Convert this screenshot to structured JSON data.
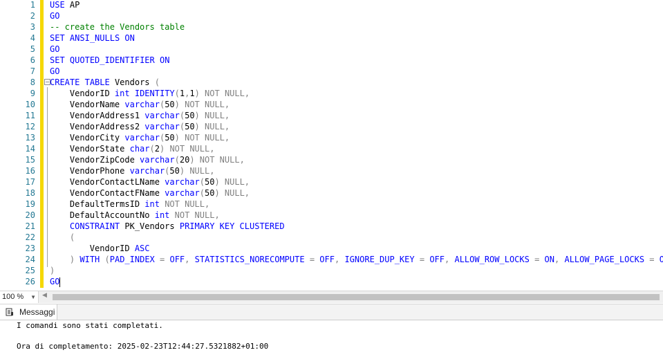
{
  "editor": {
    "lines": [
      {
        "n": "1",
        "parts": [
          [
            "kw",
            "USE"
          ],
          [
            "id",
            " AP"
          ]
        ]
      },
      {
        "n": "2",
        "parts": [
          [
            "kw",
            "GO"
          ]
        ]
      },
      {
        "n": "3",
        "parts": [
          [
            "cm",
            "-- create the Vendors table"
          ]
        ]
      },
      {
        "n": "4",
        "parts": [
          [
            "kw",
            "SET"
          ],
          [
            "id",
            " "
          ],
          [
            "kw",
            "ANSI_NULLS"
          ],
          [
            "id",
            " "
          ],
          [
            "kw",
            "ON"
          ]
        ]
      },
      {
        "n": "5",
        "parts": [
          [
            "kw",
            "GO"
          ]
        ]
      },
      {
        "n": "6",
        "parts": [
          [
            "kw",
            "SET"
          ],
          [
            "id",
            " "
          ],
          [
            "kw",
            "QUOTED_IDENTIFIER"
          ],
          [
            "id",
            " "
          ],
          [
            "kw",
            "ON"
          ]
        ]
      },
      {
        "n": "7",
        "parts": [
          [
            "kw",
            "GO"
          ]
        ]
      },
      {
        "n": "8",
        "parts": [
          [
            "kw",
            "CREATE"
          ],
          [
            "id",
            " "
          ],
          [
            "kw",
            "TABLE"
          ],
          [
            "id",
            " Vendors "
          ],
          [
            "gr",
            "("
          ]
        ]
      },
      {
        "n": "9",
        "parts": [
          [
            "id",
            "    VendorID "
          ],
          [
            "kw",
            "int"
          ],
          [
            "id",
            " "
          ],
          [
            "kw",
            "IDENTITY"
          ],
          [
            "gr",
            "("
          ],
          [
            "id",
            "1"
          ],
          [
            "gr",
            ","
          ],
          [
            "id",
            "1"
          ],
          [
            "gr",
            ")"
          ],
          [
            "id",
            " "
          ],
          [
            "gr",
            "NOT NULL,"
          ]
        ]
      },
      {
        "n": "10",
        "parts": [
          [
            "id",
            "    VendorName "
          ],
          [
            "kw",
            "varchar"
          ],
          [
            "gr",
            "("
          ],
          [
            "id",
            "50"
          ],
          [
            "gr",
            ")"
          ],
          [
            "id",
            " "
          ],
          [
            "gr",
            "NOT NULL,"
          ]
        ]
      },
      {
        "n": "11",
        "parts": [
          [
            "id",
            "    VendorAddress1 "
          ],
          [
            "kw",
            "varchar"
          ],
          [
            "gr",
            "("
          ],
          [
            "id",
            "50"
          ],
          [
            "gr",
            ")"
          ],
          [
            "id",
            " "
          ],
          [
            "gr",
            "NULL,"
          ]
        ]
      },
      {
        "n": "12",
        "parts": [
          [
            "id",
            "    VendorAddress2 "
          ],
          [
            "kw",
            "varchar"
          ],
          [
            "gr",
            "("
          ],
          [
            "id",
            "50"
          ],
          [
            "gr",
            ")"
          ],
          [
            "id",
            " "
          ],
          [
            "gr",
            "NULL,"
          ]
        ]
      },
      {
        "n": "13",
        "parts": [
          [
            "id",
            "    VendorCity "
          ],
          [
            "kw",
            "varchar"
          ],
          [
            "gr",
            "("
          ],
          [
            "id",
            "50"
          ],
          [
            "gr",
            ")"
          ],
          [
            "id",
            " "
          ],
          [
            "gr",
            "NOT NULL,"
          ]
        ]
      },
      {
        "n": "14",
        "parts": [
          [
            "id",
            "    VendorState "
          ],
          [
            "kw",
            "char"
          ],
          [
            "gr",
            "("
          ],
          [
            "id",
            "2"
          ],
          [
            "gr",
            ")"
          ],
          [
            "id",
            " "
          ],
          [
            "gr",
            "NOT NULL,"
          ]
        ]
      },
      {
        "n": "15",
        "parts": [
          [
            "id",
            "    VendorZipCode "
          ],
          [
            "kw",
            "varchar"
          ],
          [
            "gr",
            "("
          ],
          [
            "id",
            "20"
          ],
          [
            "gr",
            ")"
          ],
          [
            "id",
            " "
          ],
          [
            "gr",
            "NOT NULL,"
          ]
        ]
      },
      {
        "n": "16",
        "parts": [
          [
            "id",
            "    VendorPhone "
          ],
          [
            "kw",
            "varchar"
          ],
          [
            "gr",
            "("
          ],
          [
            "id",
            "50"
          ],
          [
            "gr",
            ")"
          ],
          [
            "id",
            " "
          ],
          [
            "gr",
            "NULL,"
          ]
        ]
      },
      {
        "n": "17",
        "parts": [
          [
            "id",
            "    VendorContactLName "
          ],
          [
            "kw",
            "varchar"
          ],
          [
            "gr",
            "("
          ],
          [
            "id",
            "50"
          ],
          [
            "gr",
            ")"
          ],
          [
            "id",
            " "
          ],
          [
            "gr",
            "NULL,"
          ]
        ]
      },
      {
        "n": "18",
        "parts": [
          [
            "id",
            "    VendorContactFName "
          ],
          [
            "kw",
            "varchar"
          ],
          [
            "gr",
            "("
          ],
          [
            "id",
            "50"
          ],
          [
            "gr",
            ")"
          ],
          [
            "id",
            " "
          ],
          [
            "gr",
            "NULL,"
          ]
        ]
      },
      {
        "n": "19",
        "parts": [
          [
            "id",
            "    DefaultTermsID "
          ],
          [
            "kw",
            "int"
          ],
          [
            "id",
            " "
          ],
          [
            "gr",
            "NOT NULL,"
          ]
        ]
      },
      {
        "n": "20",
        "parts": [
          [
            "id",
            "    DefaultAccountNo "
          ],
          [
            "kw",
            "int"
          ],
          [
            "id",
            " "
          ],
          [
            "gr",
            "NOT NULL,"
          ]
        ]
      },
      {
        "n": "21",
        "parts": [
          [
            "id",
            "    "
          ],
          [
            "kw",
            "CONSTRAINT"
          ],
          [
            "id",
            " PK_Vendors "
          ],
          [
            "kw",
            "PRIMARY KEY CLUSTERED"
          ]
        ]
      },
      {
        "n": "22",
        "parts": [
          [
            "id",
            "    "
          ],
          [
            "gr",
            "("
          ]
        ]
      },
      {
        "n": "23",
        "parts": [
          [
            "id",
            "        VendorID "
          ],
          [
            "kw",
            "ASC"
          ]
        ]
      },
      {
        "n": "24",
        "parts": [
          [
            "id",
            "    "
          ],
          [
            "gr",
            ")"
          ],
          [
            "id",
            " "
          ],
          [
            "kw",
            "WITH"
          ],
          [
            "id",
            " "
          ],
          [
            "gr",
            "("
          ],
          [
            "kw",
            "PAD_INDEX"
          ],
          [
            "id",
            " "
          ],
          [
            "gr",
            "="
          ],
          [
            "id",
            " "
          ],
          [
            "kw",
            "OFF"
          ],
          [
            "gr",
            ","
          ],
          [
            "id",
            " "
          ],
          [
            "kw",
            "STATISTICS_NORECOMPUTE"
          ],
          [
            "id",
            " "
          ],
          [
            "gr",
            "="
          ],
          [
            "id",
            " "
          ],
          [
            "kw",
            "OFF"
          ],
          [
            "gr",
            ","
          ],
          [
            "id",
            " "
          ],
          [
            "kw",
            "IGNORE_DUP_KEY"
          ],
          [
            "id",
            " "
          ],
          [
            "gr",
            "="
          ],
          [
            "id",
            " "
          ],
          [
            "kw",
            "OFF"
          ],
          [
            "gr",
            ","
          ],
          [
            "id",
            " "
          ],
          [
            "kw",
            "ALLOW_ROW_LOCKS"
          ],
          [
            "id",
            " "
          ],
          [
            "gr",
            "="
          ],
          [
            "id",
            " "
          ],
          [
            "kw",
            "ON"
          ],
          [
            "gr",
            ","
          ],
          [
            "id",
            " "
          ],
          [
            "kw",
            "ALLOW_PAGE_LOCKS"
          ],
          [
            "id",
            " "
          ],
          [
            "gr",
            "="
          ],
          [
            "id",
            " "
          ],
          [
            "kw",
            "ON"
          ],
          [
            "gr",
            ")"
          ]
        ]
      },
      {
        "n": "25",
        "parts": [
          [
            "gr",
            ")"
          ]
        ]
      },
      {
        "n": "26",
        "parts": [
          [
            "kw",
            "GO"
          ]
        ]
      }
    ]
  },
  "status": {
    "zoom": "100 %"
  },
  "output": {
    "tab_label": "Messaggi",
    "line1": "I comandi sono stati completati.",
    "line2": "Ora di completamento: 2025-02-23T12:44:27.5321882+01:00"
  },
  "colors": {
    "keyword": "#0000ff",
    "comment": "#008000",
    "operator": "#808080",
    "line_number": "#237893",
    "change_marker": "#f5d800"
  }
}
